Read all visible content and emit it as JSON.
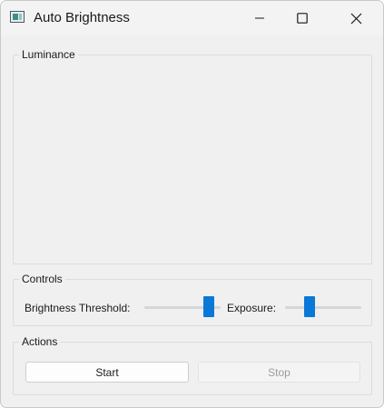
{
  "window": {
    "title": "Auto Brightness",
    "icon": "app-window-icon",
    "controls": [
      "minimize-icon",
      "maximize-icon",
      "close-icon"
    ]
  },
  "luminance": {
    "title": "Luminance"
  },
  "controls": {
    "title": "Controls",
    "brightness_threshold": {
      "label": "Brightness Threshold:",
      "value_fraction": 0.84
    },
    "exposure": {
      "label": "Exposure:",
      "value_fraction": 0.32
    }
  },
  "actions": {
    "title": "Actions",
    "start_label": "Start",
    "stop_label": "Stop",
    "stop_enabled": false
  },
  "colors": {
    "accent": "#0a78d7",
    "window_bg": "#f0f0f0",
    "disabled_text": "#9b9b9b"
  }
}
